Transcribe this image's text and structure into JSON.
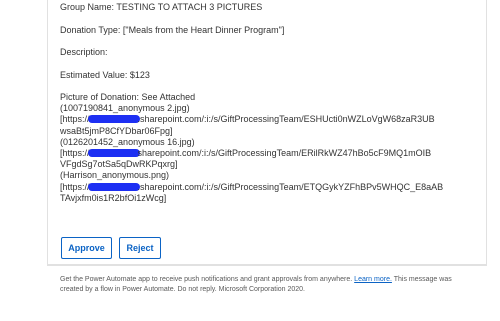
{
  "email": {
    "group_name": "Group Name: TESTING TO ATTACH 3 PICTURES",
    "donation_type": "Donation Type: [\"Meals from the Heart Dinner Program\"]",
    "description": "Description:",
    "estimated_value": "Estimated Value: $123",
    "picture_lines": {
      "l0": "Picture of Donation: See Attached",
      "l1": "(1007190841_anonymous 2.jpg)",
      "l2_pre": "[https://",
      "l2_post": ".sharepoint.com/:i:/s/GiftProcessingTeam/ESHUcti0nWZLoVgW68zaR3UB",
      "l3": "wsaBt5jmP8CfYDbar06Fpg]",
      "l4": "(0126201452_anonymous 16.jpg)",
      "l5_pre": "[https://",
      "l5_post": "sharepoint.com/:i:/s/GiftProcessingTeam/ERilRkWZ47hBo5cF9MQ1mOIB",
      "l6": "VFgdSg7otSa5qDwRKPqxrg]",
      "l7": "(Harrison_anonymous.png)",
      "l8_pre": "[https://",
      "l8_post": ".sharepoint.com/:i:/s/GiftProcessingTeam/ETQGykYZFhBPv5WHQC_E8aAB",
      "l9": "TAvjxfm0is1R2bfOi1zWcg]"
    },
    "redaction_color": "#1d2ff3"
  },
  "actions": {
    "approve_label": "Approve",
    "reject_label": "Reject",
    "accent_color": "#0b63c5"
  },
  "footer": {
    "text_before_link": "Get the Power Automate app to receive push notifications and grant approvals from anywhere. ",
    "link_text": "Learn more.",
    "text_after_link": " This message was created by a flow in Power Automate. Do not reply. Microsoft Corporation 2020."
  }
}
